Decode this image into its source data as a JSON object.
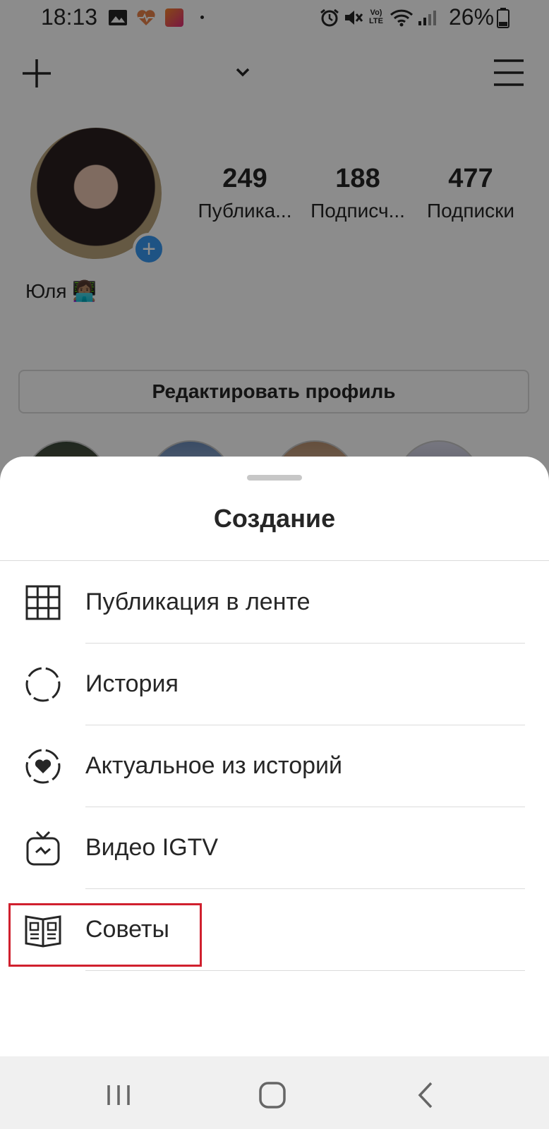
{
  "status_bar": {
    "time": "18:13",
    "battery": "26%",
    "icons": [
      "image-icon",
      "health-icon",
      "app-icon",
      "dot-icon",
      "alarm-icon",
      "mute-icon",
      "volte-icon",
      "wifi-icon",
      "signal-icon",
      "battery-icon"
    ],
    "volte": "Vo)\nLTE"
  },
  "profile": {
    "name": "Юля 👩🏽‍💻",
    "stats": [
      {
        "value": "249",
        "label": "Публика..."
      },
      {
        "value": "188",
        "label": "Подписч..."
      },
      {
        "value": "477",
        "label": "Подписки"
      }
    ],
    "edit_button": "Редактировать профиль"
  },
  "sheet": {
    "title": "Создание",
    "items": [
      {
        "label": "Публикация в ленте",
        "icon": "grid-icon"
      },
      {
        "label": "История",
        "icon": "story-circle-icon"
      },
      {
        "label": "Актуальное из историй",
        "icon": "highlight-heart-icon"
      },
      {
        "label": "Видео IGTV",
        "icon": "igtv-icon"
      },
      {
        "label": "Советы",
        "icon": "guide-book-icon"
      }
    ]
  },
  "colors": {
    "accent": "#3897f0",
    "highlight_box": "#d0202e",
    "overlay": "rgba(0,0,0,0.45)"
  },
  "nav": {
    "buttons": [
      "recents-icon",
      "home-icon",
      "back-icon"
    ]
  }
}
